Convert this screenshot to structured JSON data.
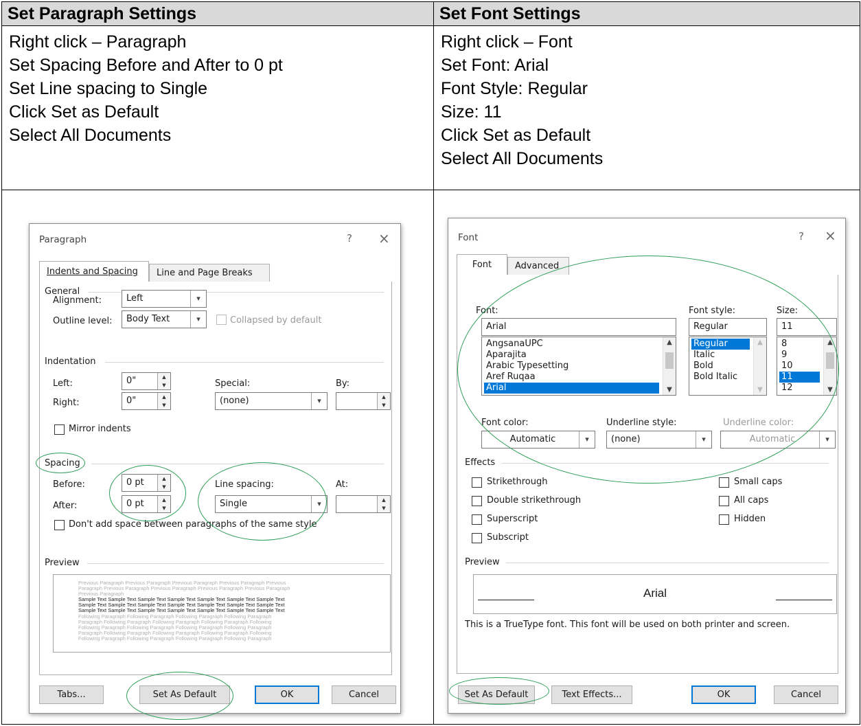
{
  "headers": {
    "left": "Set Paragraph Settings",
    "right": "Set Font Settings"
  },
  "steps": {
    "left": [
      "Right click – Paragraph",
      "Set Spacing Before and After to 0 pt",
      "Set Line spacing to Single",
      "Click Set as Default",
      "Select All Documents"
    ],
    "right": [
      "Right click – Font",
      "Set Font: Arial",
      "Font Style: Regular",
      "Size: 11",
      "Click Set as Default",
      "Select All Documents"
    ]
  },
  "paragraph_dialog": {
    "title": "Paragraph",
    "help": "?",
    "close": "×",
    "tabs": [
      "Indents and Spacing",
      "Line and Page Breaks"
    ],
    "general": {
      "heading": "General",
      "alignment_label": "Alignment:",
      "alignment_value": "Left",
      "outline_label": "Outline level:",
      "outline_value": "Body Text",
      "collapsed_label": "Collapsed by default"
    },
    "indentation": {
      "heading": "Indentation",
      "left_label": "Left:",
      "left_value": "0\"",
      "right_label": "Right:",
      "right_value": "0\"",
      "special_label": "Special:",
      "special_value": "(none)",
      "by_label": "By:",
      "mirror_label": "Mirror indents"
    },
    "spacing": {
      "heading": "Spacing",
      "before_label": "Before:",
      "before_value": "0 pt",
      "after_label": "After:",
      "after_value": "0 pt",
      "line_label": "Line spacing:",
      "line_value": "Single",
      "at_label": "At:",
      "dont_add_label": "Don't add space between paragraphs of the same style"
    },
    "preview": {
      "heading": "Preview",
      "prev_lines": [
        "Previous Paragraph Previous Paragraph Previous Paragraph Previous Paragraph Previous",
        "Paragraph Previous Paragraph Previous Paragraph Previous Paragraph Previous Paragraph",
        "Previous Paragraph"
      ],
      "sample_lines": [
        "Sample Text Sample Text Sample Text Sample Text Sample Text Sample Text Sample Text",
        "Sample Text Sample Text Sample Text Sample Text Sample Text Sample Text Sample Text",
        "Sample Text Sample Text Sample Text Sample Text Sample Text Sample Text Sample Text"
      ],
      "follow_lines": [
        "Following Paragraph Following Paragraph Following Paragraph Following Paragraph",
        "Paragraph Following Paragraph Following Paragraph Following Paragraph Following",
        "Following Paragraph Following Paragraph Following Paragraph Following Paragraph",
        "Paragraph Following Paragraph Following Paragraph Following Paragraph Following",
        "Following Paragraph Following Paragraph Following Paragraph Following Paragraph"
      ]
    },
    "buttons": {
      "tabs": "Tabs...",
      "set_default": "Set As Default",
      "ok": "OK",
      "cancel": "Cancel"
    }
  },
  "font_dialog": {
    "title": "Font",
    "help": "?",
    "close": "×",
    "tabs": [
      "Font",
      "Advanced"
    ],
    "font_label": "Font:",
    "font_value": "Arial",
    "font_list": [
      "AngsanaUPC",
      "Aparajita",
      "Arabic Typesetting",
      "Aref Ruqaa",
      "Arial"
    ],
    "style_label": "Font style:",
    "style_value": "Regular",
    "style_list": [
      "Regular",
      "Italic",
      "Bold",
      "Bold Italic"
    ],
    "size_label": "Size:",
    "size_value": "11",
    "size_list": [
      "8",
      "9",
      "10",
      "11",
      "12"
    ],
    "color_label": "Font color:",
    "color_value": "Automatic",
    "underline_label": "Underline style:",
    "underline_value": "(none)",
    "underline_color_label": "Underline color:",
    "underline_color_value": "Automatic",
    "effects": {
      "heading": "Effects",
      "left": [
        "Strikethrough",
        "Double strikethrough",
        "Superscript",
        "Subscript"
      ],
      "right": [
        "Small caps",
        "All caps",
        "Hidden"
      ]
    },
    "preview_heading": "Preview",
    "preview_text": "Arial",
    "truetype_note": "This is a TrueType font. This font will be used on both printer and screen.",
    "buttons": {
      "set_default": "Set As Default",
      "text_effects": "Text Effects...",
      "ok": "OK",
      "cancel": "Cancel"
    }
  },
  "colors": {
    "highlight": "#0078d7",
    "annotation": "#2e9e57",
    "header_bg": "#d9d9d9"
  },
  "icons": {
    "dropdown": "chevron-down-icon",
    "spinner": "spin-arrows-icon",
    "help": "question-icon",
    "close": "close-icon"
  }
}
